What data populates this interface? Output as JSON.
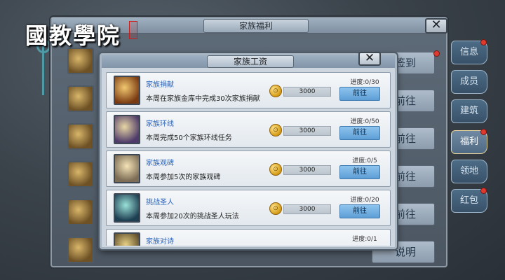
{
  "watermark": {
    "text": "國教學院"
  },
  "outer_window": {
    "title": "家族福利",
    "close_label": "✕"
  },
  "background_buttons": [
    "签到",
    "前往",
    "前往",
    "前往",
    "前往",
    "说明"
  ],
  "tabs": [
    {
      "label": "信息",
      "badge": true
    },
    {
      "label": "成员",
      "badge": false
    },
    {
      "label": "建筑",
      "badge": false
    },
    {
      "label": "福利",
      "badge": true,
      "active": true
    },
    {
      "label": "领地",
      "badge": false
    },
    {
      "label": "红包",
      "badge": true
    }
  ],
  "inner_window": {
    "title": "家族工资",
    "close_label": "✕",
    "items": [
      {
        "name": "家族捐献",
        "desc": "本周在家族金库中完成30次家族捐献",
        "reward": "3000",
        "progress": "进度:0/30",
        "button": "前往"
      },
      {
        "name": "家族环线",
        "desc": "本周完成50个家族环线任务",
        "reward": "3000",
        "progress": "进度:0/50",
        "button": "前往"
      },
      {
        "name": "家族观碑",
        "desc": "本周参加5次的家族观碑",
        "reward": "3000",
        "progress": "进度:0/5",
        "button": "前往"
      },
      {
        "name": "挑战圣人",
        "desc": "本周参加20次的挑战圣人玩法",
        "reward": "3000",
        "progress": "进度:0/20",
        "button": "前往"
      },
      {
        "name": "家族对诗",
        "desc": "",
        "reward": "",
        "progress": "进度:0/1",
        "button": ""
      }
    ]
  },
  "colors": {
    "item_name": "#2a62b8",
    "go_button": "#5d9ed6",
    "badge": "#e0392e"
  }
}
